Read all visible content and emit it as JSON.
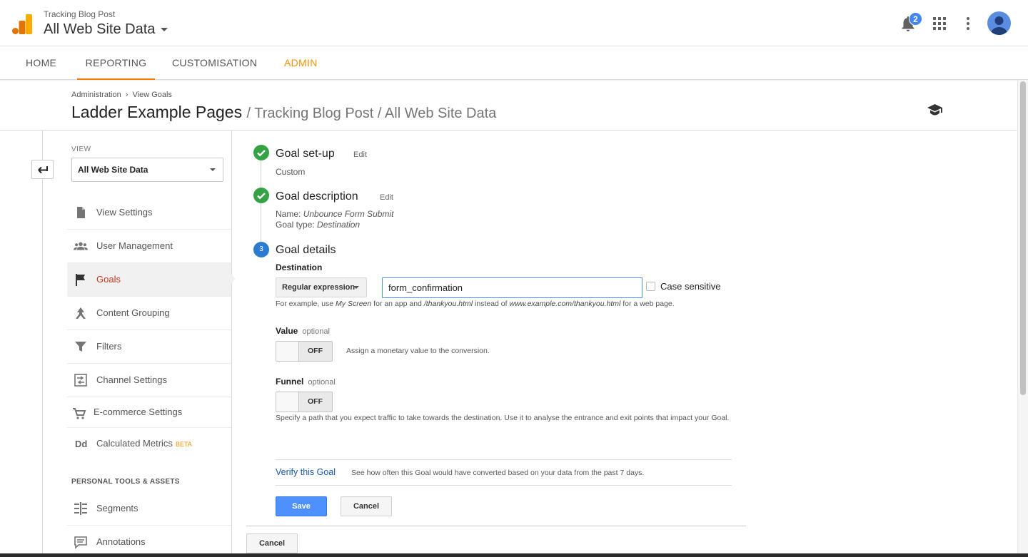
{
  "header": {
    "account_small": "Tracking Blog Post",
    "account_name": "All Web Site Data",
    "notification_count": "2"
  },
  "tabs": [
    {
      "label": "HOME"
    },
    {
      "label": "REPORTING"
    },
    {
      "label": "CUSTOMISATION"
    },
    {
      "label": "ADMIN"
    }
  ],
  "breadcrumb": {
    "root": "Administration",
    "sep": "›",
    "current": "View Goals"
  },
  "page": {
    "title": "Ladder Example Pages",
    "subtitle": "/ Tracking Blog Post / All Web Site Data"
  },
  "sidebar": {
    "view_label": "VIEW",
    "view_value": "All Web Site Data",
    "items": [
      {
        "label": "View Settings",
        "icon": "document-icon"
      },
      {
        "label": "User Management",
        "icon": "people-icon"
      },
      {
        "label": "Goals",
        "icon": "flag-icon"
      },
      {
        "label": "Content Grouping",
        "icon": "content-grouping-icon"
      },
      {
        "label": "Filters",
        "icon": "filter-icon"
      },
      {
        "label": "Channel Settings",
        "icon": "channel-icon"
      },
      {
        "label": "E-commerce Settings",
        "icon": "cart-icon"
      },
      {
        "label": "Calculated Metrics",
        "icon": "dd-icon",
        "badge": "BETA"
      }
    ],
    "section_title": "PERSONAL TOOLS & ASSETS",
    "tools": [
      {
        "label": "Segments",
        "icon": "segments-icon"
      },
      {
        "label": "Annotations",
        "icon": "annotations-icon"
      }
    ]
  },
  "steps": {
    "setup": {
      "title": "Goal set-up",
      "edit": "Edit",
      "info": "Custom"
    },
    "description": {
      "title": "Goal description",
      "edit": "Edit",
      "name_label": "Name:",
      "name_value": "Unbounce Form Submit",
      "type_label": "Goal type:",
      "type_value": "Destination"
    },
    "details": {
      "number": "3",
      "title": "Goal details"
    }
  },
  "destination": {
    "label": "Destination",
    "match_type": "Regular expression",
    "value": "form_confirmation",
    "case_sensitive_label": "Case sensitive",
    "hint_1": "For example, use",
    "hint_ex1": "My Screen",
    "hint_2": "for an app and",
    "hint_ex2": "/thankyou.html",
    "hint_3": "instead of",
    "hint_ex3": "www.example.com/thankyou.html",
    "hint_4": "for a web page."
  },
  "value_field": {
    "label": "Value",
    "optional": "optional",
    "toggle": "OFF",
    "hint": "Assign a monetary value to the conversion."
  },
  "funnel_field": {
    "label": "Funnel",
    "optional": "optional",
    "toggle": "OFF",
    "hint": "Specify a path that you expect traffic to take towards the destination. Use it to analyse the entrance and exit points that impact your Goal."
  },
  "verify": {
    "link": "Verify this Goal",
    "text": "See how often this Goal would have converted based on your data from the past 7 days."
  },
  "buttons": {
    "save": "Save",
    "cancel": "Cancel",
    "outer_cancel": "Cancel"
  },
  "colors": {
    "accent": "#f57c00",
    "admin": "#f29100",
    "primary": "#4d90fe",
    "success": "#36a246",
    "active_nav": "#c8351d",
    "link": "#1a5aa8"
  }
}
